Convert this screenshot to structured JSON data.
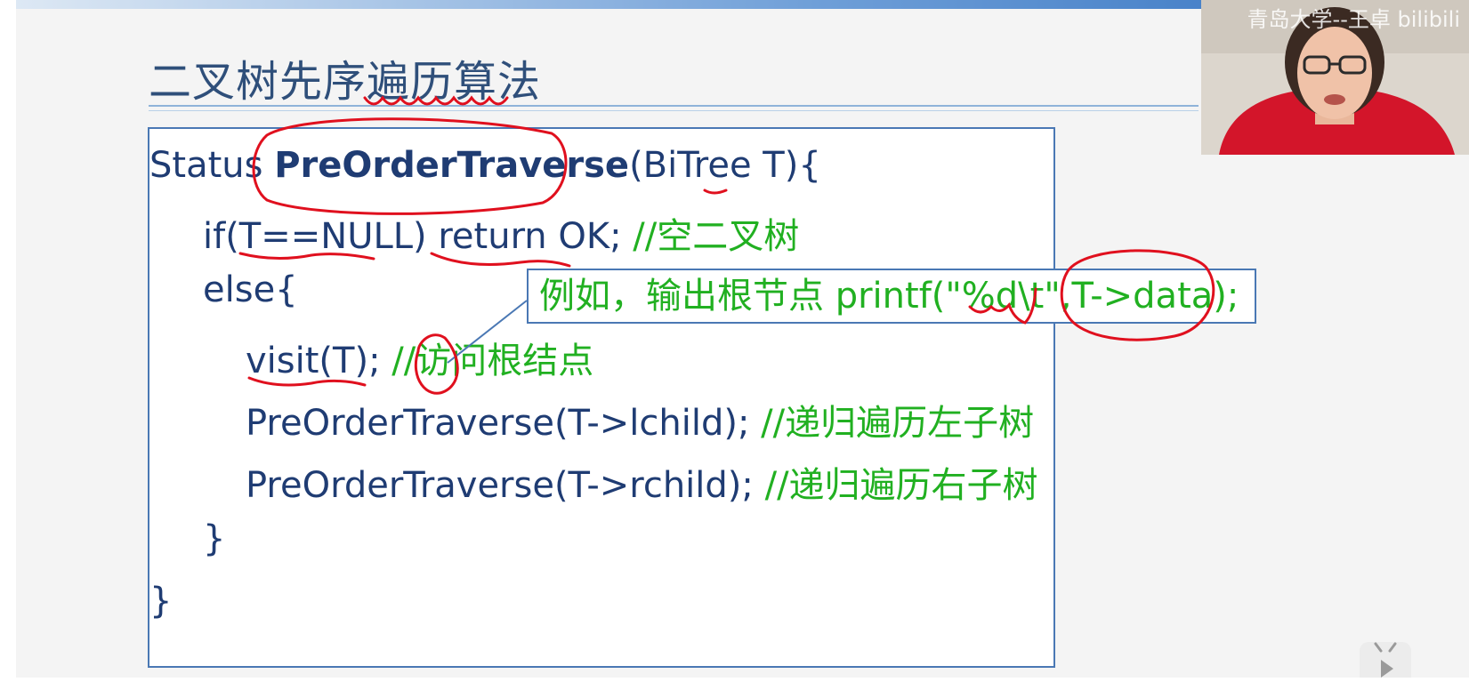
{
  "slide": {
    "title": "二叉树先序遍历算法",
    "code": {
      "line1": {
        "type": "Status ",
        "fn": "PreOrderTraverse",
        "rest": "(BiTree T){"
      },
      "line2": {
        "code": "if(T==NULL) return OK; ",
        "comment": "//空二叉树"
      },
      "line3": {
        "code": "else{"
      },
      "line4": {
        "code": "visit(T); ",
        "comment": "//访问根结点"
      },
      "line5": {
        "code": "PreOrderTraverse(T->lchild); ",
        "comment": "//递归遍历左子树"
      },
      "line6": {
        "code": "PreOrderTraverse(T->rchild); ",
        "comment": "//递归遍历右子树"
      },
      "line7": {
        "code": "}"
      },
      "line8": {
        "code": "}"
      }
    },
    "tooltip": "例如，输出根节点 printf(\"%d\\t\",T->data);"
  },
  "webcam": {
    "watermark": "青岛大学--王卓 bilibili"
  },
  "colors": {
    "code_text": "#1f3c73",
    "comment_text": "#21b021",
    "box_border": "#4a78b4",
    "annotation_red": "#e0101e"
  },
  "icons": {
    "player_logo": "bilibili-tv-icon"
  }
}
